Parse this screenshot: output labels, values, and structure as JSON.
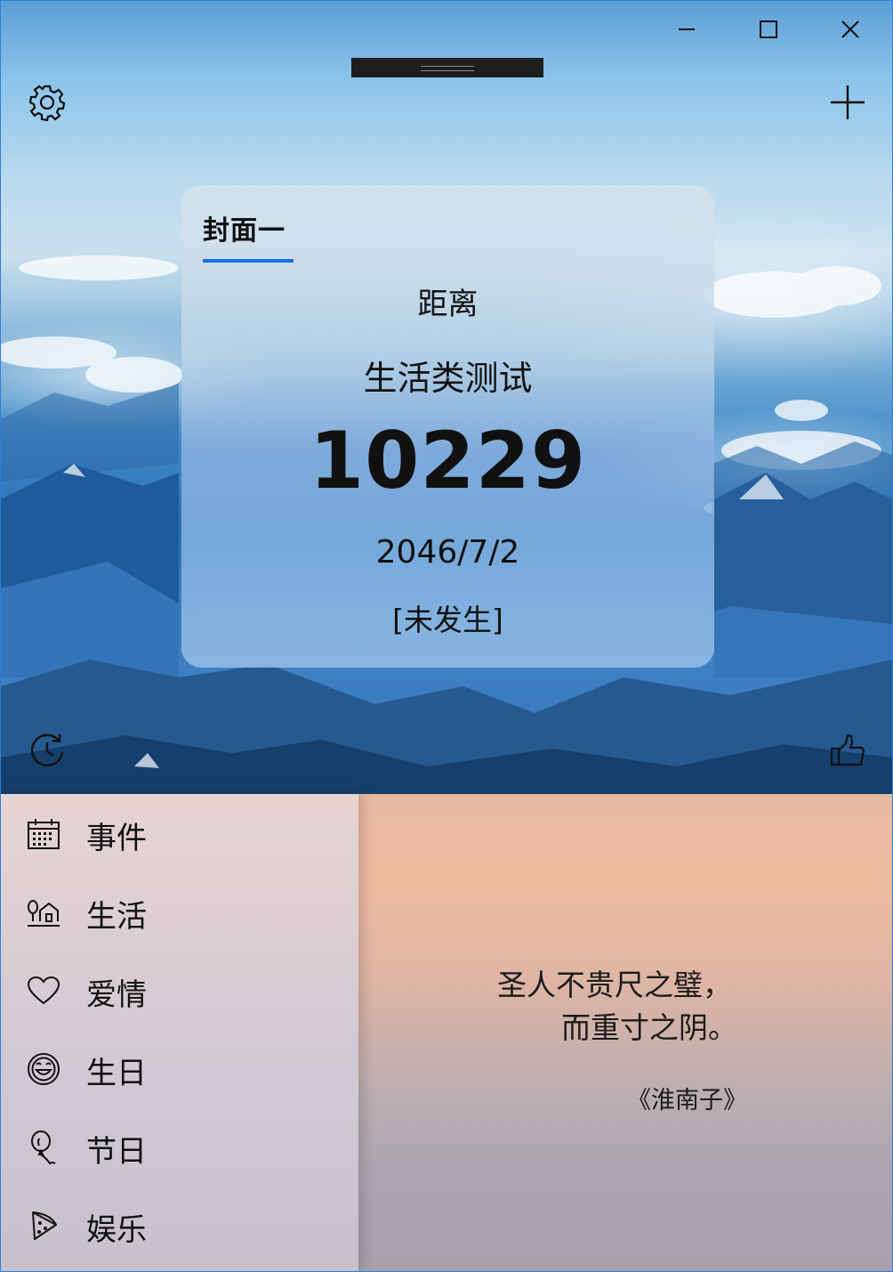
{
  "window": {
    "controls": {
      "minimize": "minimize-icon",
      "maximize": "maximize-icon",
      "close": "close-icon"
    }
  },
  "toolbar": {
    "settings_icon": "gear-icon",
    "add_icon": "plus-icon",
    "history_icon": "clock-refresh-icon",
    "like_icon": "thumbs-up-icon"
  },
  "card": {
    "tab_label": "封面一",
    "label": "距离",
    "event_name": "生活类测试",
    "days": "10229",
    "date": "2046/7/2",
    "status": "[未发生]",
    "accent_color": "#1a73d6"
  },
  "sidebar": {
    "items": [
      {
        "label": "事件",
        "icon": "calendar-icon"
      },
      {
        "label": "生活",
        "icon": "home-plant-icon"
      },
      {
        "label": "爱情",
        "icon": "heart-icon"
      },
      {
        "label": "生日",
        "icon": "smile-icon"
      },
      {
        "label": "节日",
        "icon": "balloon-icon"
      },
      {
        "label": "娱乐",
        "icon": "pizza-icon"
      }
    ]
  },
  "quote": {
    "line1": "圣人不贵尺之璧，",
    "line2": "而重寸之阴。",
    "source": "《淮南子》"
  }
}
